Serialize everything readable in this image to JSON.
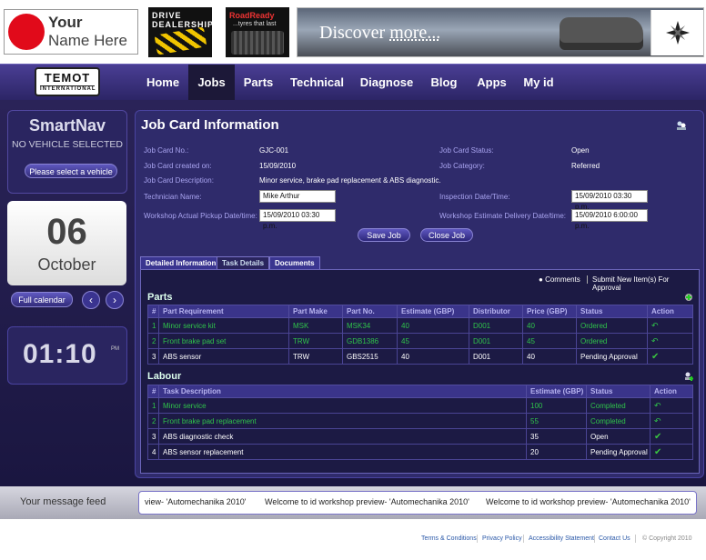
{
  "banner": {
    "logo_line1": "Your",
    "logo_line2": "Name Here",
    "ad1_text": "DRIVE DEALERSHIP",
    "ad2_brand": "RoadReady",
    "ad2_tag": "...tyres that last",
    "ad3_text_a": "Discover ",
    "ad3_text_b": "more...",
    "compass_icon": "compass-star-icon"
  },
  "nav": {
    "brand_top": "TEMOT",
    "brand_bottom": "INTERNATIONAL",
    "items": [
      "Home",
      "Jobs",
      "Parts",
      "Technical",
      "Diagnose",
      "Blog",
      "Apps",
      "My id"
    ],
    "active": "Jobs"
  },
  "sidebar": {
    "smartnav_title": "SmartNav",
    "smartnav_status": "NO VEHICLE SELECTED",
    "select_vehicle": "Please select a vehicle",
    "cal_day": "06",
    "cal_month": "October",
    "full_calendar": "Full calendar",
    "prev": "‹",
    "next": "›",
    "clock_time": "01:10",
    "clock_ampm": "PM"
  },
  "panel": {
    "title": "Job Card Information",
    "fields": {
      "job_card_no_label": "Job Card No.:",
      "job_card_no": "GJC-001",
      "created_label": "Job Card created on:",
      "created": "15/09/2010",
      "desc_label": "Job Card Description:",
      "desc": "Minor service, brake pad replacement & ABS diagnostic.",
      "tech_label": "Technician Name:",
      "tech": "Mike Arthur",
      "pickup_label": "Workshop Actual Pickup Date/time:",
      "pickup": "15/09/2010 03:30 p.m.",
      "status_label": "Job Card Status:",
      "status": "Open",
      "category_label": "Job Category:",
      "category": "Referred",
      "inspection_label": "Inspection Date/Time:",
      "inspection": "15/09/2010 03:30 p.m.",
      "delivery_label": "Workshop Estimate Delivery Date/time:",
      "delivery": "15/09/2010 6:00:00 p.m."
    },
    "save_job": "Save Job",
    "close_job": "Close Job",
    "tabs": [
      "Detailed Information",
      "Task Details",
      "Documents"
    ],
    "active_tab": "Task Details",
    "comments": "Comments",
    "submit_new": "Submit New Item(s) For Approval",
    "parts_title": "Parts",
    "parts_headers": [
      "#",
      "Part Requirement",
      "Part Make",
      "Part No.",
      "Estimate (GBP)",
      "Distributor",
      "Price (GBP)",
      "Status",
      "Action"
    ],
    "parts_rows": [
      [
        "1",
        "Minor service kit",
        "MSK",
        "MSK34",
        "40",
        "D001",
        "40",
        "Ordered",
        "↶"
      ],
      [
        "2",
        "Front brake pad set",
        "TRW",
        "GDB1386",
        "45",
        "D001",
        "45",
        "Ordered",
        "↶"
      ],
      [
        "3",
        "ABS sensor",
        "TRW",
        "GBS2515",
        "40",
        "D001",
        "40",
        "Pending Approval",
        "✔"
      ]
    ],
    "labour_title": "Labour",
    "labour_headers": [
      "#",
      "Task Description",
      "Estimate (GBP)",
      "Status",
      "Action"
    ],
    "labour_rows": [
      [
        "1",
        "Minor service",
        "100",
        "Completed",
        "↶"
      ],
      [
        "2",
        "Front brake pad replacement",
        "55",
        "Completed",
        "↶"
      ],
      [
        "3",
        "ABS diagnostic check",
        "35",
        "Open",
        "✔"
      ],
      [
        "4",
        "ABS sensor replacement",
        "20",
        "Pending Approval",
        "✔"
      ]
    ]
  },
  "feed": {
    "label": "Your message feed",
    "msg1": "view- 'Automechanika 2010'",
    "msg2": "Welcome to id workshop preview- 'Automechanika 2010'",
    "msg3": "Welcome to id workshop preview- 'Automechanika 2010'"
  },
  "footer": {
    "links": [
      "Terms & Conditions",
      "Privacy Policy",
      "Accessibility Statement",
      "Contact Us"
    ],
    "copyright": "© Copyright 2010"
  },
  "colors": {
    "accent": "#2f2b6b",
    "nav_bg": "#3c3280",
    "green_status": "#2fc34a",
    "label_purple": "#a9a4f0"
  }
}
